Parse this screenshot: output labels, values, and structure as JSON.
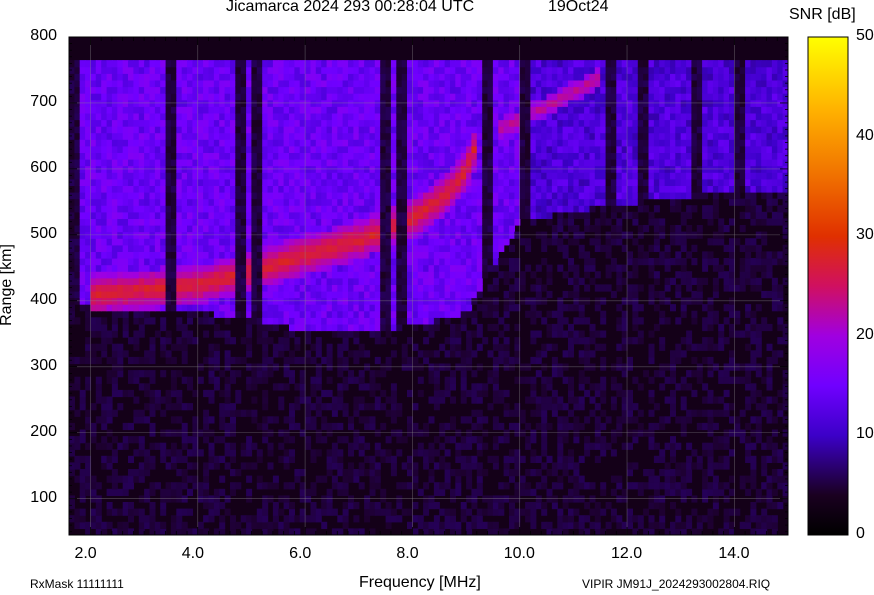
{
  "header": {
    "title": "Jicamarca 2024 293 00:28:04 UTC",
    "date": "19Oct24"
  },
  "colorbar": {
    "label": "SNR [dB]",
    "ticks": [
      "0",
      "10",
      "20",
      "30",
      "40",
      "50"
    ],
    "range": [
      0,
      50
    ]
  },
  "footer": {
    "rxmask": "RxMask 11111111",
    "file": "VIPIR  JM91J_2024293002804.RIQ"
  },
  "chart_data": {
    "type": "heatmap",
    "title": "Jicamarca 2024 293 00:28:04 UTC",
    "xlabel": "Frequency [MHz]",
    "ylabel": "Range [km]",
    "xlim": [
      1.6,
      15.0
    ],
    "ylim": [
      45,
      800
    ],
    "xticks": [
      2.0,
      4.0,
      6.0,
      8.0,
      10.0,
      12.0,
      14.0
    ],
    "xtick_labels": [
      "2.0",
      "4.0",
      "6.0",
      "8.0",
      "10.0",
      "12.0",
      "14.0"
    ],
    "yticks": [
      100,
      200,
      300,
      400,
      500,
      600,
      700,
      800
    ],
    "ytick_labels": [
      "100",
      "200",
      "300",
      "400",
      "500",
      "600",
      "700",
      "800"
    ],
    "grid": true,
    "colorbar": {
      "label": "SNR [dB]",
      "min": 0,
      "max": 50
    },
    "noise_floor_db": 3,
    "f_region_onset_km": [
      [
        1.7,
        400
      ],
      [
        2.5,
        388
      ],
      [
        4.0,
        383
      ],
      [
        5.0,
        372
      ],
      [
        6.0,
        355
      ],
      [
        7.0,
        352
      ],
      [
        8.0,
        362
      ],
      [
        9.0,
        382
      ],
      [
        10.0,
        520
      ],
      [
        11.6,
        545
      ],
      [
        12.0,
        548
      ],
      [
        14.0,
        565
      ],
      [
        15.0,
        562
      ]
    ],
    "o_trace_km": [
      [
        2.0,
        410
      ],
      [
        3.0,
        418
      ],
      [
        4.0,
        425
      ],
      [
        5.0,
        445
      ],
      [
        6.0,
        470
      ],
      [
        7.0,
        492
      ],
      [
        8.0,
        525
      ],
      [
        8.6,
        560
      ],
      [
        9.0,
        598
      ],
      [
        9.2,
        640
      ]
    ],
    "x_trace_km": [
      [
        9.6,
        660
      ],
      [
        10.5,
        695
      ],
      [
        11.5,
        740
      ]
    ],
    "trace_snr_db": 27,
    "diffuse_snr_db": 14,
    "dark_columns_mhz": [
      1.7,
      3.5,
      4.8,
      5.1,
      7.5,
      7.8,
      9.4,
      10.1,
      11.7,
      12.3,
      13.3,
      14.1
    ]
  }
}
